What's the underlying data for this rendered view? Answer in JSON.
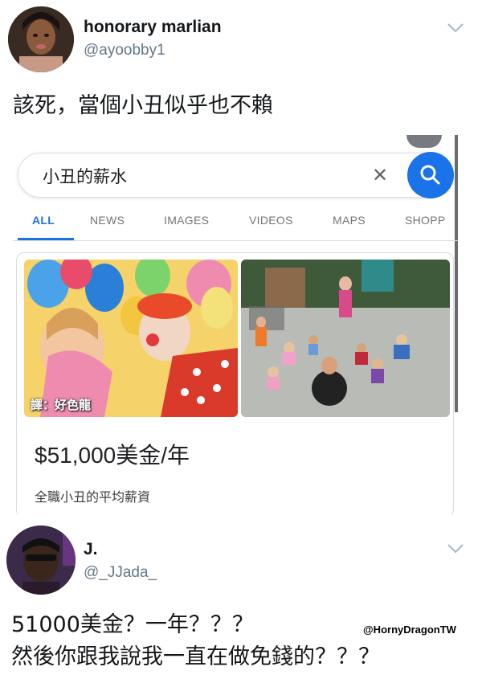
{
  "tweet1": {
    "display_name": "honorary marlian",
    "handle": "@ayoobby1",
    "text": "該死，當個小丑似乎也不賴"
  },
  "google": {
    "search_value": "小丑的薪水",
    "tabs": [
      "ALL",
      "NEWS",
      "IMAGES",
      "VIDEOS",
      "MAPS",
      "SHOPP"
    ],
    "active_tab": "ALL",
    "image_tag": "譯：好色龍",
    "salary": "$51,000美金/年",
    "salary_desc": "全職小丑的平均薪資"
  },
  "tweet2": {
    "display_name": "J.",
    "handle": "@_JJada_",
    "line1": "51000美金？一年？？？",
    "line2": "然後你跟我說我一直在做免錢的？？？"
  },
  "credit": "@HornyDragonTW",
  "colors": {
    "google_blue": "#1a73e8",
    "twitter_gray": "#657786"
  }
}
